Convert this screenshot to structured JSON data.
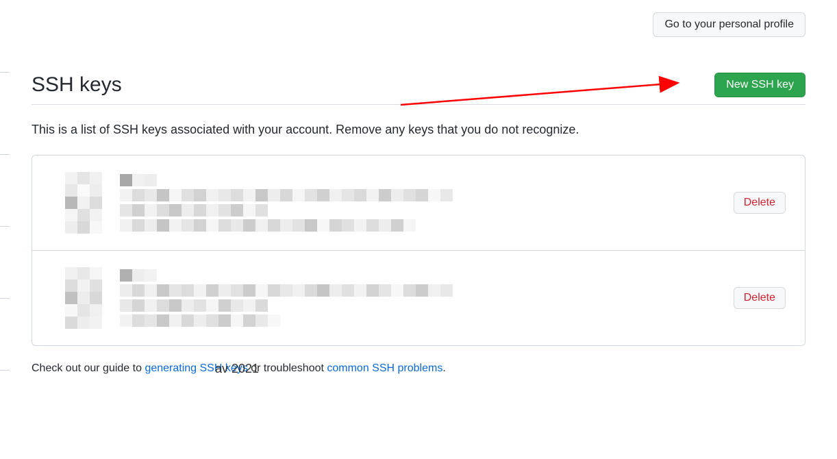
{
  "top": {
    "profile_button": "Go to your personal profile"
  },
  "header": {
    "title": "SSH keys",
    "new_key_button": "New SSH key"
  },
  "description": "This is a list of SSH keys associated with your account. Remove any keys that you do not recognize.",
  "keys": [
    {
      "delete_label": "Delete"
    },
    {
      "delete_label": "Delete"
    }
  ],
  "fragment_text": "av 2021",
  "footer": {
    "prefix": "Check out our guide to ",
    "link1": "generating SSH keys",
    "middle": " or troubleshoot ",
    "link2": "common SSH problems",
    "suffix": "."
  },
  "colors": {
    "primary_green": "#2da44e",
    "danger_red": "#cf222e",
    "link_blue": "#0969da",
    "arrow_red": "#ff0000"
  }
}
